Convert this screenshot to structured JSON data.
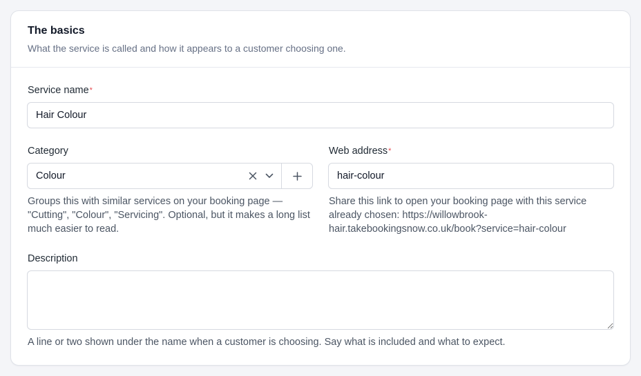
{
  "section": {
    "title": "The basics",
    "subtitle": "What the service is called and how it appears to a customer choosing one."
  },
  "service_name": {
    "label": "Service name",
    "required_mark": "*",
    "value": "Hair Colour"
  },
  "category": {
    "label": "Category",
    "selected": "Colour",
    "help": "Groups this with similar services on your booking page — \"Cutting\", \"Colour\", \"Servicing\". Optional, but it makes a long list much easier to read.",
    "clear_icon": "close-icon",
    "dropdown_icon": "chevron-down-icon",
    "add_icon": "plus-icon"
  },
  "web_address": {
    "label": "Web address",
    "required_mark": "*",
    "value": "hair-colour",
    "help": "Share this link to open your booking page with this service already chosen: https://willowbrook-hair.takebookingsnow.co.uk/book?service=hair-colour"
  },
  "description": {
    "label": "Description",
    "value": "",
    "help": "A line or two shown under the name when a customer is choosing. Say what is included and what to expect."
  },
  "colors": {
    "required": "#e5484d",
    "border": "#d6d9e0",
    "muted_text": "#667085"
  }
}
